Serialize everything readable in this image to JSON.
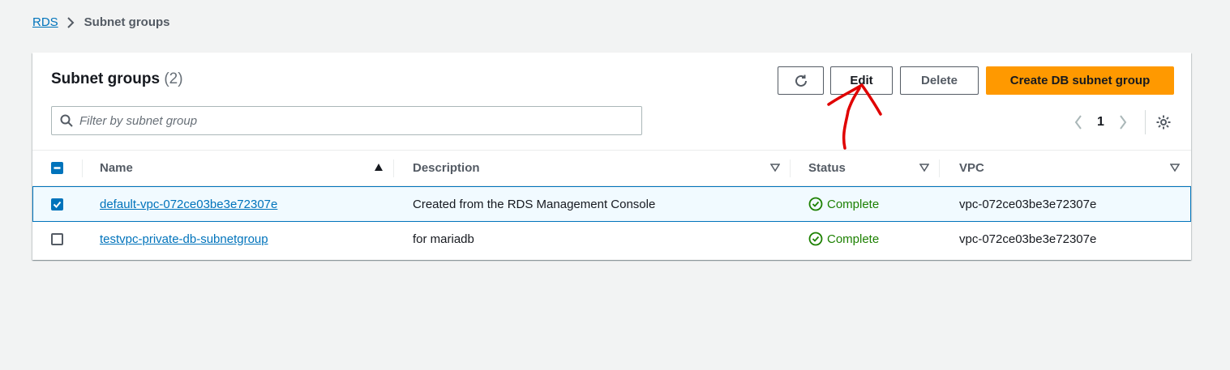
{
  "breadcrumb": {
    "root": "RDS",
    "current": "Subnet groups"
  },
  "panel": {
    "title": "Subnet groups",
    "count": "(2)"
  },
  "toolbar": {
    "refresh_icon": "refresh-icon",
    "edit_label": "Edit",
    "delete_label": "Delete",
    "create_label": "Create DB subnet group"
  },
  "filter": {
    "placeholder": "Filter by subnet group",
    "value": ""
  },
  "pagination": {
    "current_page": "1"
  },
  "table": {
    "columns": [
      "Name",
      "Description",
      "Status",
      "VPC"
    ],
    "rows": [
      {
        "selected": true,
        "name": "default-vpc-072ce03be3e72307e",
        "description": "Created from the RDS Management Console",
        "status": "Complete",
        "vpc": "vpc-072ce03be3e72307e"
      },
      {
        "selected": false,
        "name": "testvpc-private-db-subnetgroup",
        "description": "for mariadb",
        "status": "Complete",
        "vpc": "vpc-072ce03be3e72307e"
      }
    ]
  },
  "colors": {
    "link": "#0073bb",
    "primary": "#ff9900",
    "success": "#1d8102",
    "annotation": "#e00000"
  }
}
